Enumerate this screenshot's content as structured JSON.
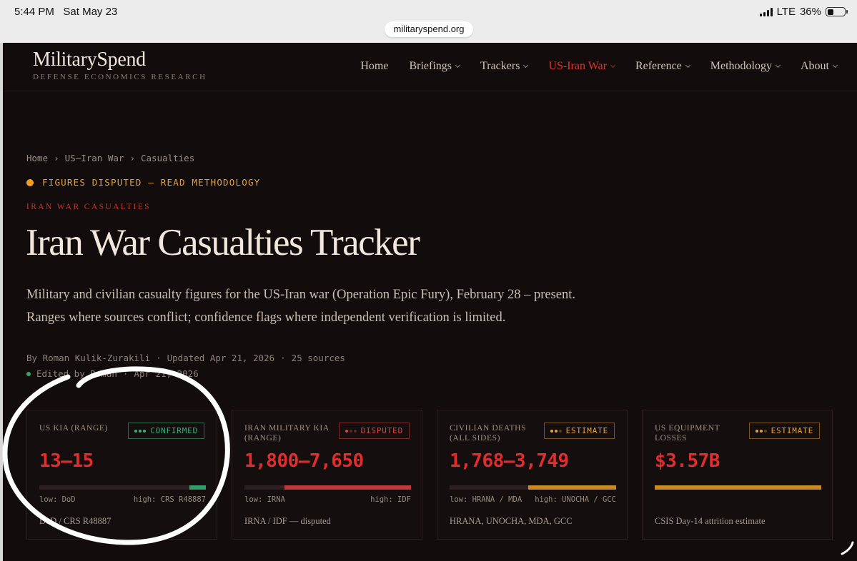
{
  "status_bar": {
    "time": "5:44 PM",
    "date": "Sat May 23",
    "network": "LTE",
    "battery": "36%",
    "url": "militaryspend.org"
  },
  "site": {
    "logo": "MilitarySpend",
    "tagline": "DEFENSE ECONOMICS RESEARCH"
  },
  "nav": {
    "items": [
      {
        "label": "Home",
        "dropdown": false,
        "active": false
      },
      {
        "label": "Briefings",
        "dropdown": true,
        "active": false
      },
      {
        "label": "Trackers",
        "dropdown": true,
        "active": false
      },
      {
        "label": "US-Iran War",
        "dropdown": true,
        "active": true
      },
      {
        "label": "Reference",
        "dropdown": true,
        "active": false
      },
      {
        "label": "Methodology",
        "dropdown": true,
        "active": false
      },
      {
        "label": "About",
        "dropdown": true,
        "active": false
      }
    ]
  },
  "breadcrumb": [
    "Home",
    "US–Iran War",
    "Casualties"
  ],
  "breadcrumb_separator": "›",
  "disputed_banner": "FIGURES DISPUTED — READ METHODOLOGY",
  "kicker": "IRAN WAR CASUALTIES",
  "title": "Iran War Casualties Tracker",
  "lede": "Military and civilian casualty figures for the US-Iran war (Operation Epic Fury), February 28 – present. Ranges where sources conflict; confidence flags where independent verification is limited.",
  "byline": {
    "author": "By Roman Kulik-Zurakili",
    "updated": "Updated Apr 21, 2026",
    "sources": "25 sources",
    "separator": "·"
  },
  "edited": {
    "by": "Edited by Roman",
    "date": "Apr 21, 2026"
  },
  "cards": [
    {
      "label": "US KIA (RANGE)",
      "badge": "CONFIRMED",
      "badge_type": "confirmed",
      "value": "13–15",
      "bar": {
        "start": 0.9,
        "end": 1.0,
        "color": "#2f9e6a"
      },
      "low": "low: DoD",
      "high": "high: CRS R48887",
      "source": "DoD / CRS R48887"
    },
    {
      "label": "IRAN MILITARY KIA (RANGE)",
      "badge": "DISPUTED",
      "badge_type": "disputed",
      "value": "1,800–7,650",
      "bar": {
        "start": 0.24,
        "end": 1.0,
        "color": "#c0393a"
      },
      "low": "low: IRNA",
      "high": "high: IDF",
      "source": "IRNA / IDF — disputed"
    },
    {
      "label": "CIVILIAN DEATHS (ALL SIDES)",
      "badge": "ESTIMATE",
      "badge_type": "estimate",
      "value": "1,768–3,749",
      "bar": {
        "start": 0.47,
        "end": 1.0,
        "color": "#c98a23"
      },
      "low": "low: HRANA / MDA",
      "high": "high: UNOCHA / GCC",
      "source": "HRANA, UNOCHA, MDA, GCC"
    },
    {
      "label": "US EQUIPMENT LOSSES",
      "badge": "ESTIMATE",
      "badge_type": "estimate",
      "value": "$3.57B",
      "bar": {
        "start": 0.0,
        "end": 1.0,
        "color": "#c98a23"
      },
      "low": "",
      "high": "",
      "source": "CSIS Day-14 attrition estimate"
    }
  ],
  "colors": {
    "background": "#130c0d",
    "accent_red": "#e22d2d",
    "disputed_orange": "#f0a020",
    "confirmed_green": "#2f9e6a"
  }
}
